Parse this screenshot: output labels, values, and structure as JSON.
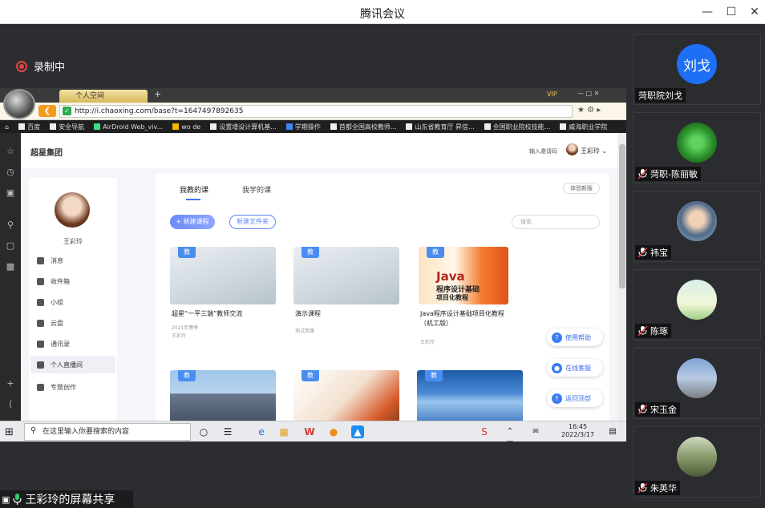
{
  "app": {
    "title": "腾讯会议",
    "recording_label": "录制中",
    "share_label": "王彩玲的屏幕共享"
  },
  "browser": {
    "tab_title": "个人空间",
    "vip_label": "VIP",
    "url": "http://i.chaoxing.com/base?t=1647497892635",
    "bookmarks": [
      "百度",
      "安全导航",
      "AirDroid Web_viv...",
      "wo de",
      "设置增设计算机基...",
      "学期操作",
      "首都全国高校教师...",
      "山东省教育厅 昇信...",
      "全国职业院校技能...",
      "威海职业学院"
    ]
  },
  "page": {
    "brand": "超星集团",
    "invite": "输入邀请码",
    "user_name": "王彩玲",
    "profile_name": "王彩玲",
    "menu": [
      {
        "label": "消息",
        "icon": "bell-icon"
      },
      {
        "label": "收件箱",
        "icon": "mail-icon"
      },
      {
        "label": "小组",
        "icon": "group-icon"
      },
      {
        "label": "云盘",
        "icon": "cloud-icon"
      },
      {
        "label": "通讯录",
        "icon": "contacts-icon"
      },
      {
        "label": "个人直播间",
        "icon": "live-icon"
      },
      {
        "label": "专题创作",
        "icon": "topic-icon"
      }
    ],
    "tabs": [
      "我教的课",
      "我学的课"
    ],
    "experience": "体验新版",
    "new_course": "+ 新建课程",
    "new_folder": "新建文件夹",
    "search_placeholder": "搜索",
    "course_badge": "教",
    "courses": [
      {
        "title": "超星“一平三端”教师交流",
        "meta1": "2021年春季",
        "meta2": "王彩玲"
      },
      {
        "title": "演示课程",
        "meta1": "测试用课",
        "meta2": ""
      },
      {
        "title": "Java程序设计基础项目化教程（机工版）",
        "meta1": "",
        "meta2": "王彩玲"
      }
    ],
    "java_cover": {
      "line1": "Java",
      "line2": "程序设计基础",
      "line3": "项目化教程"
    },
    "float_buttons": [
      "使用帮助",
      "在线客服",
      "返回顶部"
    ]
  },
  "taskbar": {
    "search_text": "在这里输入你要搜索的内容",
    "time": "16:45",
    "date": "2022/3/17"
  },
  "participants": [
    {
      "name": "菏职院刘戈",
      "avatar_text": "刘戈",
      "muted": false
    },
    {
      "name": "菏职-陈丽敏",
      "avatar_text": "",
      "muted": true
    },
    {
      "name": "祎宝",
      "avatar_text": "",
      "muted": true
    },
    {
      "name": "陈琢",
      "avatar_text": "",
      "muted": true
    },
    {
      "name": "宋玉金",
      "avatar_text": "",
      "muted": true
    },
    {
      "name": "朱英华",
      "avatar_text": "",
      "muted": true
    }
  ],
  "colors": {
    "accent": "#3a7bf3",
    "record": "#e54545",
    "avatar_blue": "#1e6ff5"
  }
}
